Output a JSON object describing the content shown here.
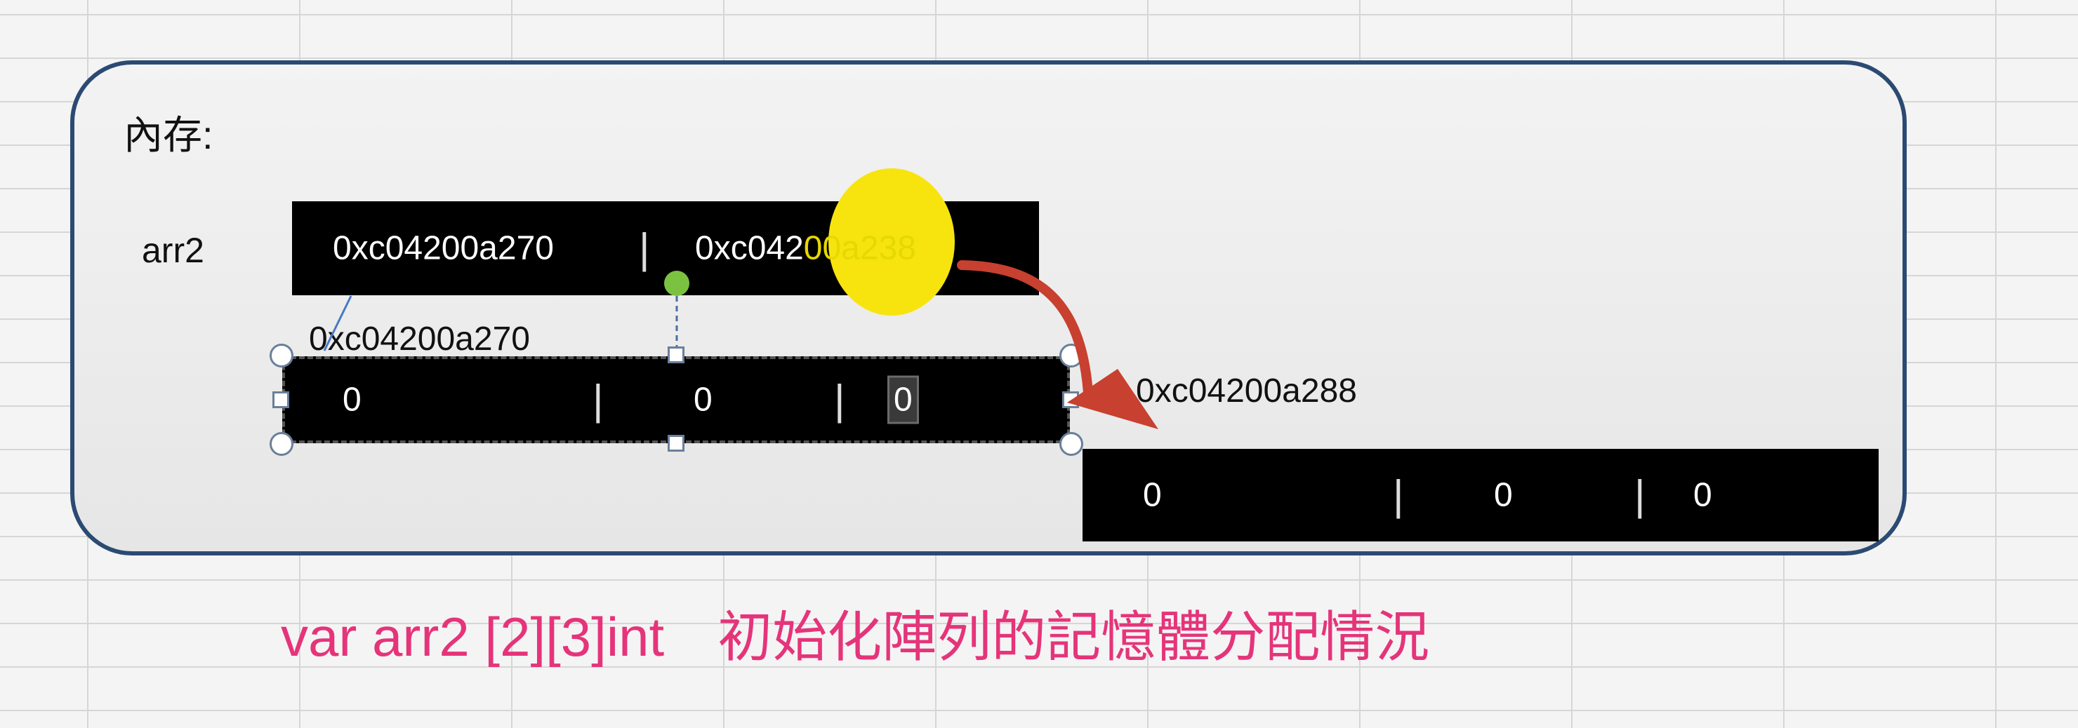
{
  "memory_label": "內存:",
  "array_label": "arr2",
  "top_row": {
    "cell0": "0xc04200a270",
    "cell1_pre": "0xc042",
    "cell1_post": "00a238",
    "separator": "|"
  },
  "row1": {
    "address": "0xc04200a270",
    "values": [
      "0",
      "0",
      "0"
    ],
    "separator": "|"
  },
  "row2": {
    "address": "0xc04200a288",
    "values": [
      "0",
      "0",
      "0"
    ],
    "separator": "|"
  },
  "caption": {
    "code": "var arr2 [2][3]int",
    "text": "初始化陣列的記憶體分配情況"
  },
  "colors": {
    "caption": "#e5347a",
    "arrow": "#c8402f",
    "highlight": "#f7e40f",
    "panel_border": "#2b4a73"
  }
}
